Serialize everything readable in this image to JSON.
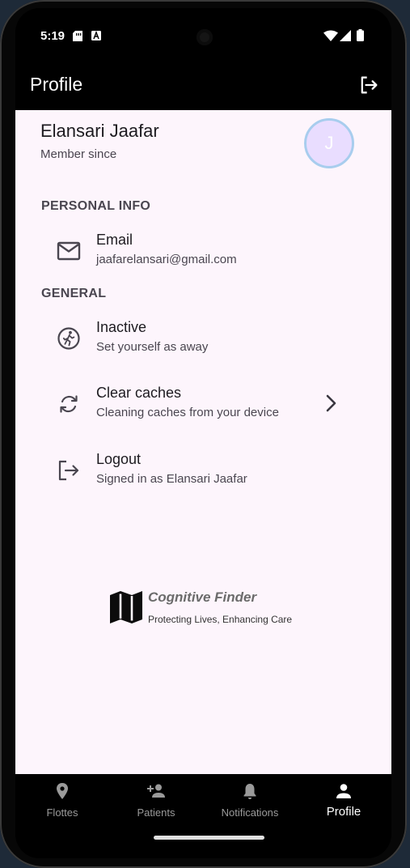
{
  "status_bar": {
    "time": "5:19"
  },
  "app_bar": {
    "title": "Profile",
    "logout_icon": "logout-icon"
  },
  "profile": {
    "name": "Elansari Jaafar",
    "member_since": "Member since",
    "avatar_initial": "J"
  },
  "sections": {
    "personal_info": "PERSONAL INFO",
    "general": "GENERAL"
  },
  "tiles": [
    {
      "icon": "mail-icon",
      "title": "Email",
      "subtitle": "jaafarelansari@gmail.com"
    },
    {
      "icon": "running-person-icon",
      "title": "Inactive",
      "subtitle": "Set yourself as away"
    },
    {
      "icon": "sync-icon",
      "title": "Clear caches",
      "subtitle": "Cleaning caches from your device"
    },
    {
      "icon": "logout-icon",
      "title": "Logout",
      "subtitle": "Signed in as Elansari Jaafar"
    }
  ],
  "brand": {
    "name": "Cognitive Finder",
    "tagline": "Protecting Lives, Enhancing Care",
    "icon": "map-icon"
  },
  "bottom_nav": [
    {
      "label": "Flottes",
      "icon": "location-pin-icon",
      "active": false
    },
    {
      "label": "Patients",
      "icon": "person-add-icon",
      "active": false
    },
    {
      "label": "Notifications",
      "icon": "bell-icon",
      "active": false
    },
    {
      "label": "Profile",
      "icon": "person-icon",
      "active": true
    }
  ],
  "colors": {
    "content_background": "#fdf5fc",
    "bar_background": "#000000",
    "avatar_fill": "#e9ddff",
    "avatar_ring": "#a8cdee",
    "nav_active": "#ffffff",
    "nav_inactive": "#9a9a9a"
  }
}
